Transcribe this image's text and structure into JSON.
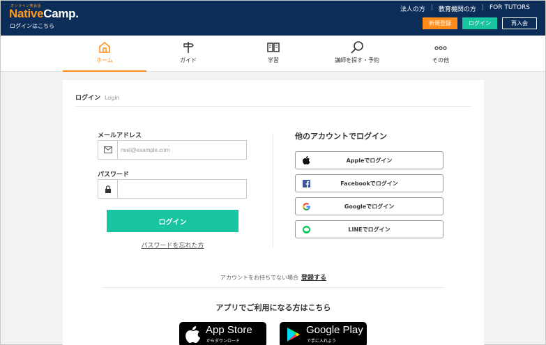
{
  "header": {
    "logo_sub": "オンライン英会話",
    "logo_native": "Native",
    "logo_camp": "Camp.",
    "login_link": "ログインはこちら",
    "toplinks": [
      "法人の方",
      "教育機関の方",
      "FOR TUTORS"
    ],
    "separator": "|",
    "register_label": "新規登録",
    "login_label": "ログイン",
    "rejoin_label": "再入会"
  },
  "nav": {
    "items": [
      {
        "label": "ホーム",
        "icon": "home-icon"
      },
      {
        "label": "ガイド",
        "icon": "signpost-icon"
      },
      {
        "label": "学習",
        "icon": "book-icon"
      },
      {
        "label": "講師を探す・予約",
        "icon": "search-icon"
      },
      {
        "label": "その他",
        "icon": "more-icon"
      }
    ],
    "active_index": 0
  },
  "card": {
    "title": "ログイン",
    "title_en": "Login",
    "email_label": "メールアドレス",
    "email_placeholder": "mail@example.com",
    "email_value": "",
    "password_label": "パスワード",
    "password_value": "",
    "submit_label": "ログイン",
    "forgot_label": "パスワードを忘れた方",
    "social_title": "他のアカウントでログイン",
    "social": [
      {
        "label": "Appleでログイン",
        "icon": "apple-icon"
      },
      {
        "label": "Facebookでログイン",
        "icon": "facebook-icon"
      },
      {
        "label": "Googleでログイン",
        "icon": "google-icon"
      },
      {
        "label": "LINEでログイン",
        "icon": "line-icon"
      }
    ],
    "no_account_text": "アカウントをお持ちでない場合",
    "register_link": "登録する",
    "app_title": "アプリでご利用になる方はこちら",
    "app_store_big": "App Store",
    "app_store_small": "からダウンロード",
    "google_play_big": "Google Play",
    "google_play_small": "で手に入れよう"
  },
  "colors": {
    "header_bg": "#0c2d57",
    "accent_orange": "#ff8c1a",
    "accent_green": "#19c4a1"
  }
}
